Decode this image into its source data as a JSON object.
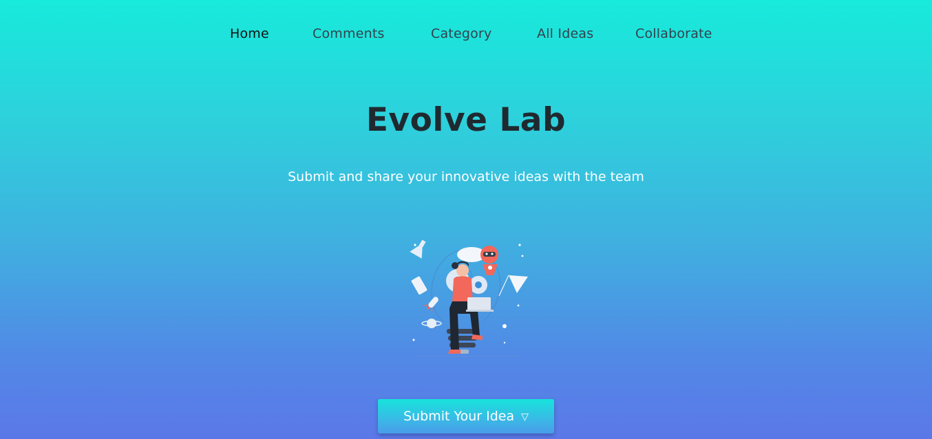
{
  "nav": {
    "items": [
      {
        "label": "Home",
        "active": true
      },
      {
        "label": "Comments"
      },
      {
        "label": "Category"
      },
      {
        "label": "All Ideas"
      },
      {
        "label": "Collaborate"
      }
    ]
  },
  "hero": {
    "title": "Evolve Lab",
    "subtitle": "Submit and share your innovative ideas with the team",
    "illustration": "person-with-laptop-on-lightbulb-illustration"
  },
  "cta": {
    "label": "Submit Your Idea",
    "icon": "triangle-down-icon",
    "icon_glyph": "▽"
  },
  "colors": {
    "gradient_top": "#17eadb",
    "gradient_bottom": "#5b78e8",
    "title": "#1f2a30",
    "accent_robot": "#f2685a"
  }
}
